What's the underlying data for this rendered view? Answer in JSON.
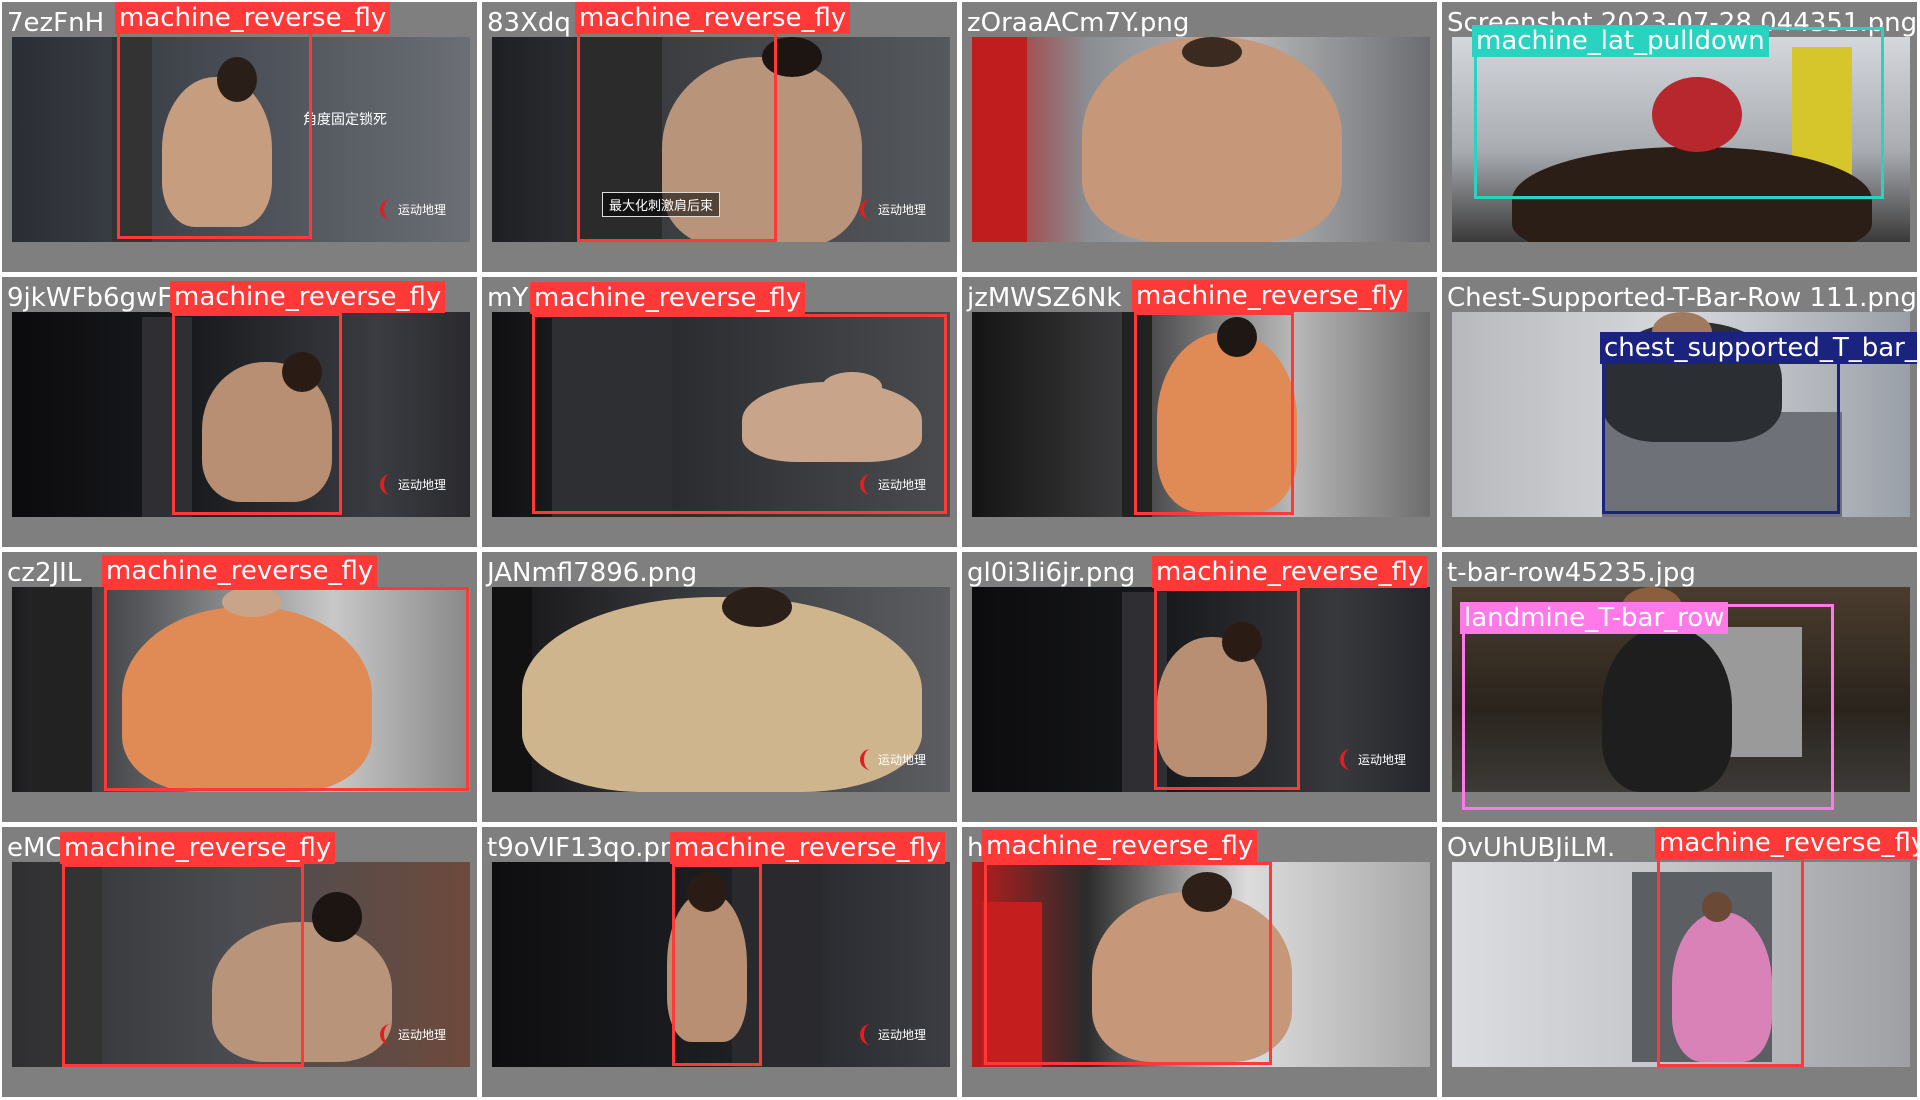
{
  "colors": {
    "tile_bg": "#7f7f7f",
    "machine_reverse_fly": "#ff3838",
    "machine_lat_pulldown": "#2ad3c0",
    "chest_supported_T_bar_row": "#1a237e",
    "landmine_T-bar_row": "#ff7ae8"
  },
  "tiles": [
    {
      "filename": "7ezFnH",
      "label": "machine_reverse_fly",
      "overlay_text": "角度固定锁死",
      "logo_text": "运动地理"
    },
    {
      "filename": "83Xdq",
      "label": "machine_reverse_fly",
      "overlay_text": "最大化刺激肩后束",
      "logo_text": "运动地理"
    },
    {
      "filename": "zOraaACm7Y.png",
      "label": ""
    },
    {
      "filename": "Screenshot 2023-07-28 044351.png",
      "label": "machine_lat_pulldown"
    },
    {
      "filename": "9jkWFb6gwF",
      "label": "machine_reverse_fly",
      "logo_text": "运动地理"
    },
    {
      "filename": "mY",
      "label": "machine_reverse_fly",
      "logo_text": "运动地理"
    },
    {
      "filename": "jzMWSZ6Nk",
      "label": "machine_reverse_fly"
    },
    {
      "filename": "Chest-Supported-T-Bar-Row 111.png",
      "label": "chest_supported_T_bar_row"
    },
    {
      "filename": "cz2JIL",
      "label": "machine_reverse_fly"
    },
    {
      "filename": "JANmfl7896.png",
      "label": "",
      "logo_text": "运动地理"
    },
    {
      "filename": "gl0i3li6jr.png",
      "label": "machine_reverse_fly",
      "logo_text": "运动地理"
    },
    {
      "filename": "t-bar-row45235.jpg",
      "label": "landmine_T-bar_row"
    },
    {
      "filename": "eMC",
      "label": "machine_reverse_fly",
      "logo_text": "运动地理"
    },
    {
      "filename": "t9oVIF13qo.pn",
      "label": "machine_reverse_fly",
      "logo_text": "运动地理"
    },
    {
      "filename": "h",
      "label": "machine_reverse_fly"
    },
    {
      "filename": "OvUhUBJiLM.",
      "label": "machine_reverse_fly"
    }
  ]
}
